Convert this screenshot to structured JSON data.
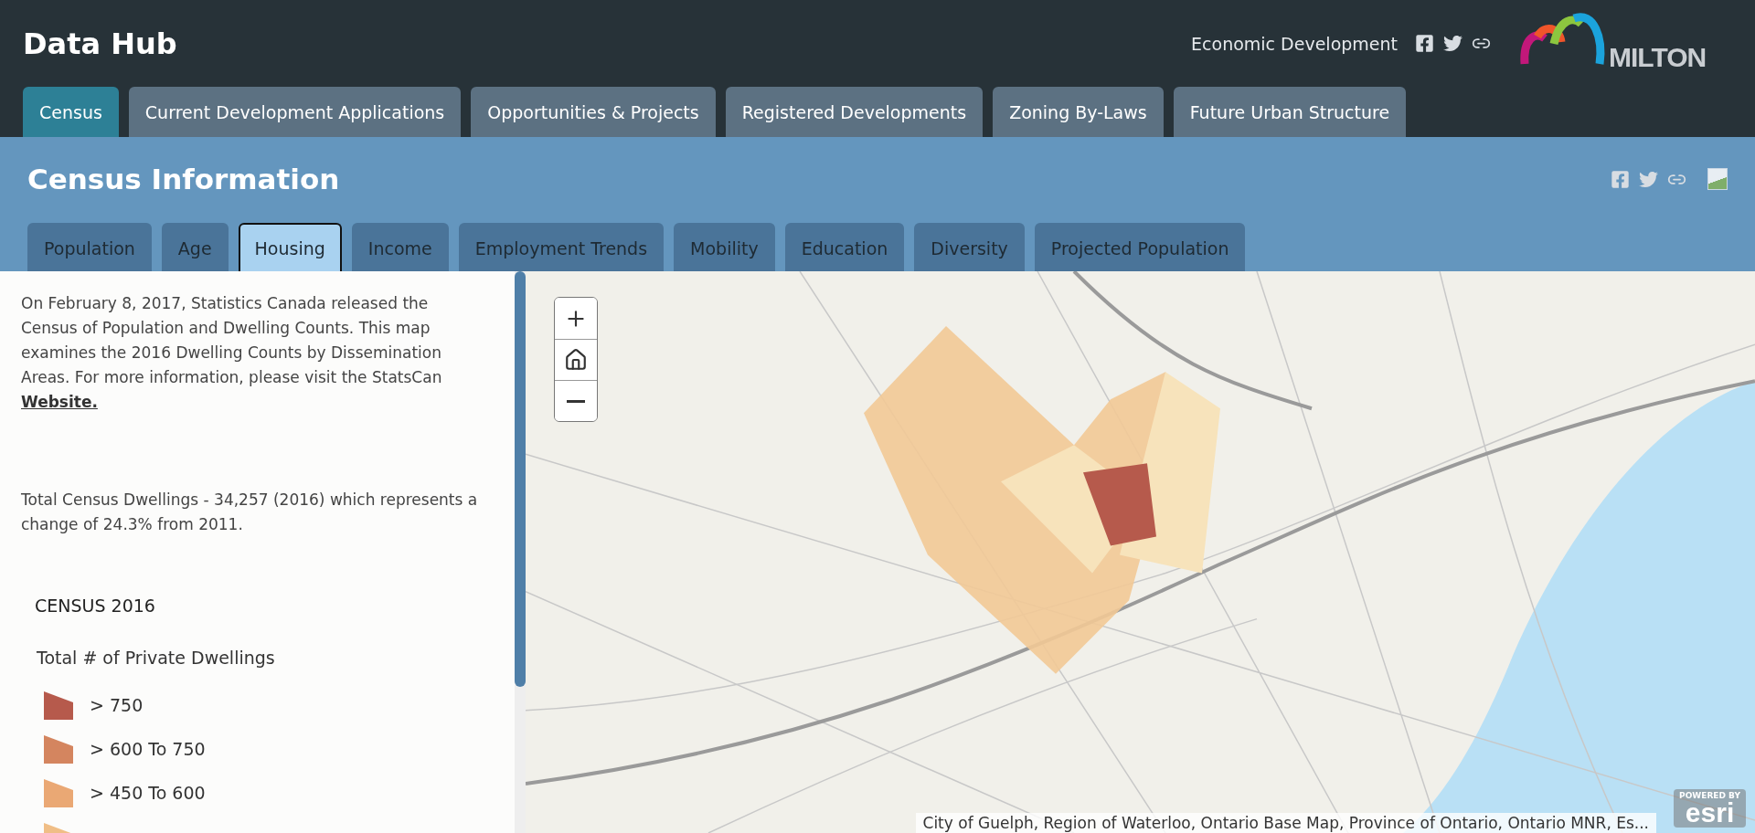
{
  "header": {
    "title": "Data Hub",
    "org_link": "Economic Development",
    "logo_text": "MILTON"
  },
  "main_tabs": [
    {
      "label": "Census",
      "selected": true
    },
    {
      "label": "Current Development Applications",
      "selected": false
    },
    {
      "label": "Opportunities & Projects",
      "selected": false
    },
    {
      "label": "Registered Developments",
      "selected": false
    },
    {
      "label": "Zoning By-Laws",
      "selected": false
    },
    {
      "label": "Future Urban Structure",
      "selected": false
    }
  ],
  "section": {
    "title": "Census Information"
  },
  "sub_tabs": [
    {
      "label": "Population",
      "selected": false
    },
    {
      "label": "Age",
      "selected": false
    },
    {
      "label": "Housing",
      "selected": true
    },
    {
      "label": "Income",
      "selected": false
    },
    {
      "label": "Employment Trends",
      "selected": false
    },
    {
      "label": "Mobility",
      "selected": false
    },
    {
      "label": "Education",
      "selected": false
    },
    {
      "label": "Diversity",
      "selected": false
    },
    {
      "label": "Projected Population",
      "selected": false
    }
  ],
  "panel": {
    "intro": "On February 8, 2017, Statistics Canada released the Census of Population and Dwelling Counts. This map examines the 2016 Dwelling Counts by Dissemination Areas. For more information, please visit the StatsCan",
    "link": "Website.",
    "summary": "Total Census Dwellings - 34,257 (2016) which represents a change of 24.3% from 2011.",
    "legend": {
      "title": "CENSUS 2016",
      "subtitle": "Total # of Private Dwellings",
      "items": [
        {
          "label": "> 750",
          "color": "#b65a4c"
        },
        {
          "label": "> 600 To 750",
          "color": "#d4855f"
        },
        {
          "label": "> 450 To 600",
          "color": "#eaa874"
        },
        {
          "color": "#f0be86"
        }
      ]
    }
  },
  "map": {
    "attribution": "City of Guelph, Region of Waterloo, Ontario Base Map, Province of Ontario, Ontario MNR, Es...",
    "powered_by": "POWERED BY",
    "brand": "esri"
  }
}
